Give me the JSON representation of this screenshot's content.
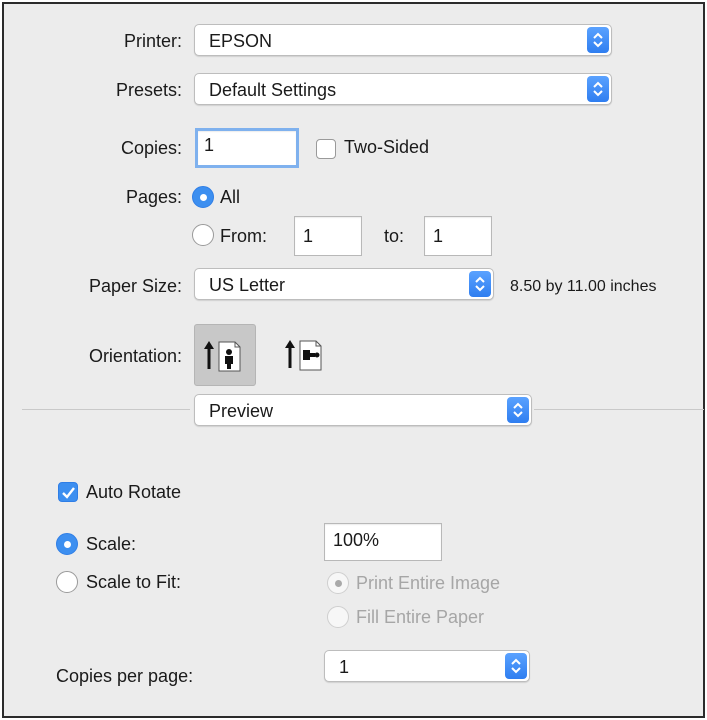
{
  "printer": {
    "label": "Printer:",
    "value": "EPSON"
  },
  "presets": {
    "label": "Presets:",
    "value": "Default Settings"
  },
  "copies": {
    "label": "Copies:",
    "value": "1",
    "two_sided_label": "Two-Sided",
    "two_sided_checked": false
  },
  "pages": {
    "label": "Pages:",
    "all_label": "All",
    "from_label": "From:",
    "from_value": "1",
    "to_label": "to:",
    "to_value": "1",
    "selected": "All"
  },
  "paper_size": {
    "label": "Paper Size:",
    "value": "US Letter",
    "dimensions": "8.50 by 11.00 inches"
  },
  "orientation": {
    "label": "Orientation:",
    "options": [
      "portrait",
      "landscape"
    ],
    "selected": "portrait"
  },
  "section_menu": {
    "value": "Preview"
  },
  "preview": {
    "auto_rotate_label": "Auto Rotate",
    "auto_rotate_checked": true,
    "scale_label": "Scale:",
    "scale_value": "100%",
    "scale_to_fit_label": "Scale to Fit:",
    "selected_scaling": "Scale",
    "print_entire_image_label": "Print Entire Image",
    "fill_entire_paper_label": "Fill Entire Paper",
    "copies_per_page_label": "Copies per page:",
    "copies_per_page_value": "1"
  },
  "colors": {
    "accent": "#3d8ff0",
    "background": "#ececec"
  }
}
